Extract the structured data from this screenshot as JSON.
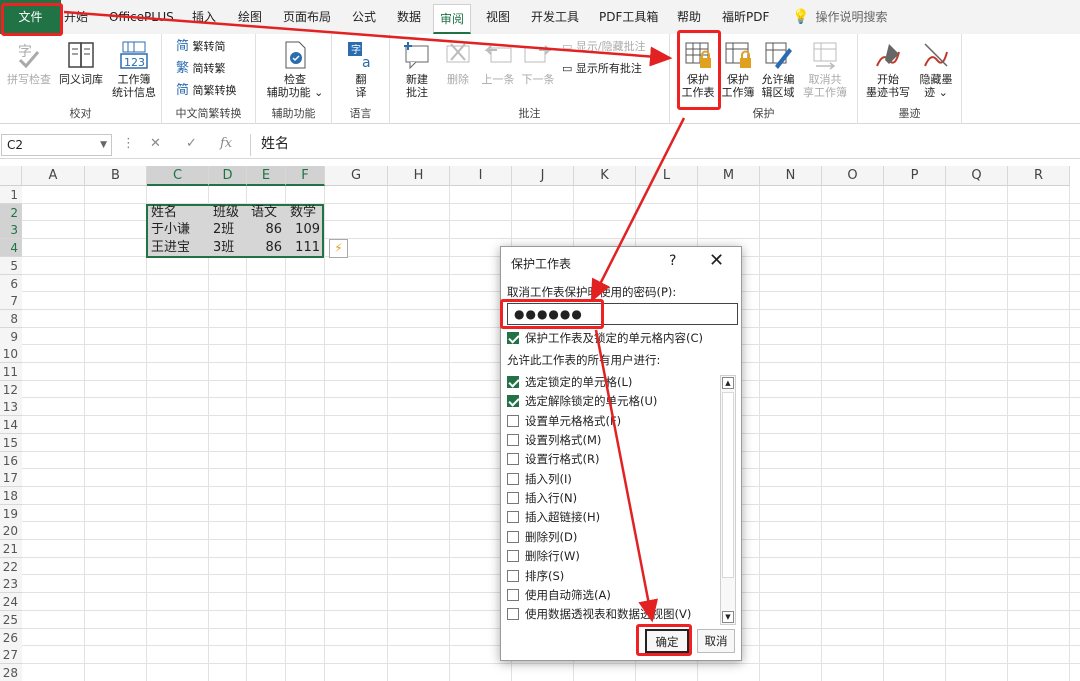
{
  "menu": {
    "tabs": [
      "文件",
      "开始",
      "OfficePLUS",
      "插入",
      "绘图",
      "页面布局",
      "公式",
      "数据",
      "审阅",
      "视图",
      "开发工具",
      "PDF工具箱",
      "帮助",
      "福昕PDF"
    ],
    "active_tab": "审阅",
    "search": "操作说明搜索"
  },
  "ribbon": {
    "proof": {
      "spell": "拼写检查",
      "thesaurus": "同义词库",
      "stats1": "工作簿",
      "stats2": "统计信息",
      "label": "校对"
    },
    "chinese": {
      "t2s": "繁转简",
      "s2t": "简转繁",
      "convert": "简繁转换",
      "label": "中文简繁转换"
    },
    "access": {
      "check1": "检查",
      "check2": "辅助功能 ⌄",
      "label": "辅助功能"
    },
    "lang": {
      "translate1": "翻",
      "translate2": "译",
      "label": "语言"
    },
    "comments": {
      "new1": "新建",
      "new2": "批注",
      "delete": "删除",
      "prev": "上一条",
      "next": "下一条",
      "show_hide": "显示/隐藏批注",
      "show_all": "显示所有批注",
      "label": "批注"
    },
    "protect": {
      "sheet1": "保护",
      "sheet2": "工作表",
      "wb1": "保护",
      "wb2": "工作簿",
      "allow1": "允许编",
      "allow2": "辑区域",
      "unshare1": "取消共",
      "unshare2": "享工作簿",
      "label": "保护"
    },
    "ink": {
      "start1": "开始",
      "start2": "墨迹书写",
      "hide1": "隐藏墨",
      "hide2": "迹 ⌄",
      "label": "墨迹"
    }
  },
  "formula_bar": {
    "name_box": "C2",
    "fx": "fx",
    "content": "姓名"
  },
  "columns": [
    "A",
    "B",
    "C",
    "D",
    "E",
    "F",
    "G",
    "H",
    "I",
    "J",
    "K",
    "L",
    "M",
    "N",
    "O",
    "P",
    "Q",
    "R"
  ],
  "rows": [
    "1",
    "2",
    "3",
    "4",
    "5",
    "6",
    "7",
    "8",
    "9",
    "10",
    "11",
    "12",
    "13",
    "14",
    "15",
    "16",
    "17",
    "18",
    "19",
    "20",
    "21",
    "22",
    "23",
    "24",
    "25",
    "26",
    "27",
    "28"
  ],
  "table": {
    "headers": [
      "姓名",
      "班级",
      "语文",
      "数学"
    ],
    "rows": [
      [
        "于小谦",
        "2班",
        "86",
        "109"
      ],
      [
        "王进宝",
        "3班",
        "86",
        "111"
      ]
    ]
  },
  "dialog": {
    "title": "保护工作表",
    "help": "?",
    "close": "✕",
    "password_label": "取消工作表保护时使用的密码(P):",
    "password_value": "●●●●●●",
    "protect_contents": "保护工作表及锁定的单元格内容(C)",
    "allow_label": "允许此工作表的所有用户进行:",
    "options": [
      {
        "label": "选定锁定的单元格(L)",
        "checked": true
      },
      {
        "label": "选定解除锁定的单元格(U)",
        "checked": true
      },
      {
        "label": "设置单元格格式(F)",
        "checked": false
      },
      {
        "label": "设置列格式(M)",
        "checked": false
      },
      {
        "label": "设置行格式(R)",
        "checked": false
      },
      {
        "label": "插入列(I)",
        "checked": false
      },
      {
        "label": "插入行(N)",
        "checked": false
      },
      {
        "label": "插入超链接(H)",
        "checked": false
      },
      {
        "label": "删除列(D)",
        "checked": false
      },
      {
        "label": "删除行(W)",
        "checked": false
      },
      {
        "label": "排序(S)",
        "checked": false
      },
      {
        "label": "使用自动筛选(A)",
        "checked": false
      },
      {
        "label": "使用数据透视表和数据透视图(V)",
        "checked": false
      }
    ],
    "ok": "确定",
    "cancel": "取消"
  },
  "colors": {
    "accent": "#217346",
    "annotation": "#e22222"
  }
}
